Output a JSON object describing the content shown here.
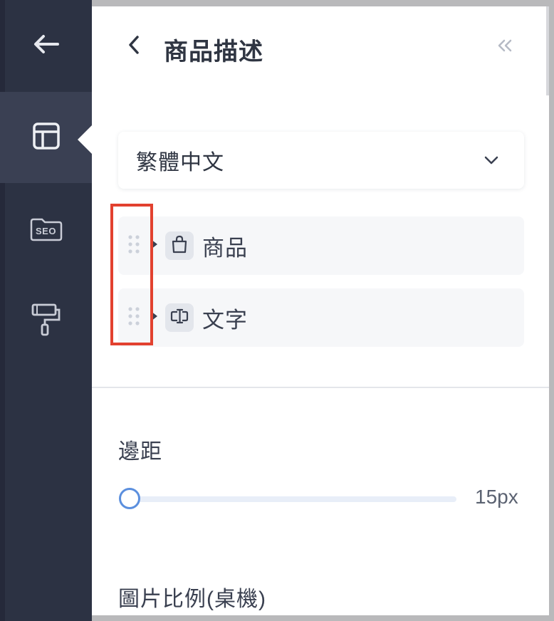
{
  "sidebar": {
    "back_icon": "arrow-left-icon",
    "items": [
      {
        "name": "layout",
        "icon": "layout-icon",
        "active": true
      },
      {
        "name": "seo",
        "icon": "seo-folder-icon",
        "label": "SEO",
        "active": false
      },
      {
        "name": "theme",
        "icon": "paint-roller-icon",
        "active": false
      }
    ]
  },
  "header": {
    "title": "商品描述",
    "back_icon": "chevron-left-icon",
    "collapse_icon": "double-chevron-left-icon"
  },
  "language_select": {
    "value": "繁體中文",
    "icon": "chevron-down-icon"
  },
  "blocks": [
    {
      "label": "商品",
      "icon": "shopping-bag-icon"
    },
    {
      "label": "文字",
      "icon": "text-field-icon"
    }
  ],
  "margin": {
    "label": "邊距",
    "value": "15px",
    "level": 0.0
  },
  "image_ratio": {
    "label": "圖片比例(桌機)"
  },
  "colors": {
    "sidebar_bg": "#2c3243",
    "sidebar_active": "#3a4053",
    "highlight": "#e2412f",
    "slider_accent": "#5b8fde",
    "text": "#2f3542"
  }
}
